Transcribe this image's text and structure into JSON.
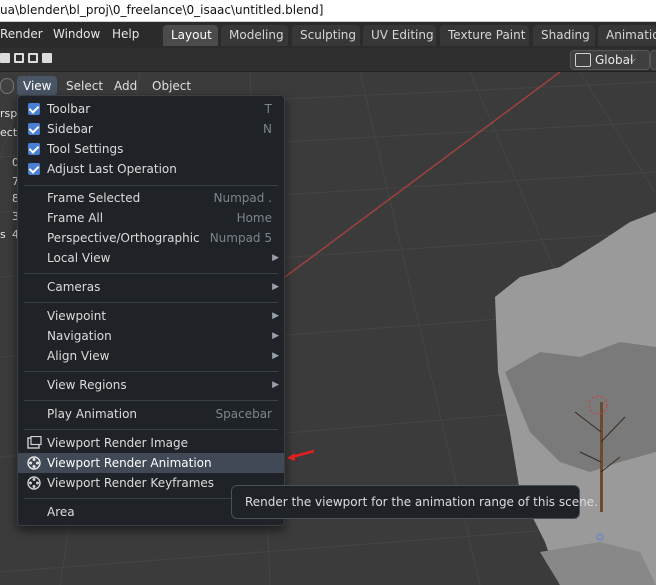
{
  "window": {
    "title": "ua\\blender\\bl_proj\\0_freelance\\0_isaac\\untitled.blend]"
  },
  "topmenu": [
    "Render",
    "Window",
    "Help"
  ],
  "workspaces": [
    "Layout",
    "Modeling",
    "Sculpting",
    "UV Editing",
    "Texture Paint",
    "Shading",
    "Animation"
  ],
  "orientation": {
    "value": "Global"
  },
  "viewport_header": {
    "menus": [
      "View",
      "Select",
      "Add",
      "Object"
    ]
  },
  "overlay_text": {
    "line1": "rspe",
    "line2": "ectio",
    "col_a": [
      "0",
      "7",
      "8",
      "3",
      "s"
    ],
    "col_b": [
      "",
      "",
      "",
      "",
      "4"
    ]
  },
  "view_menu": {
    "items": [
      {
        "label": "Toolbar",
        "shortcut": "T",
        "checkbox": true
      },
      {
        "label": "Sidebar",
        "shortcut": "N",
        "checkbox": true
      },
      {
        "label": "Tool Settings",
        "shortcut": "",
        "checkbox": true
      },
      {
        "label": "Adjust Last Operation",
        "shortcut": "",
        "checkbox": true
      },
      {
        "label": "Frame Selected",
        "shortcut": "Numpad ."
      },
      {
        "label": "Frame All",
        "shortcut": "Home"
      },
      {
        "label": "Perspective/Orthographic",
        "shortcut": "Numpad 5"
      },
      {
        "label": "Local View",
        "submenu": true
      },
      {
        "label": "Cameras",
        "submenu": true
      },
      {
        "label": "Viewpoint",
        "submenu": true
      },
      {
        "label": "Navigation",
        "submenu": true
      },
      {
        "label": "Align View",
        "submenu": true
      },
      {
        "label": "View Regions",
        "submenu": true
      },
      {
        "label": "Play Animation",
        "shortcut": "Spacebar"
      },
      {
        "label": "Viewport Render Image",
        "icon": "render-image-icon"
      },
      {
        "label": "Viewport Render Animation",
        "icon": "render-animation-icon",
        "highlighted": true
      },
      {
        "label": "Viewport Render Keyframes",
        "icon": "render-keyframes-icon"
      },
      {
        "label": "Area",
        "submenu": true
      }
    ]
  },
  "tooltip": {
    "text": "Render the viewport for the animation range of this scene."
  },
  "colors": {
    "accent": "#4a7fd1",
    "highlight": "#414957",
    "menu_bg": "#1f2226"
  }
}
